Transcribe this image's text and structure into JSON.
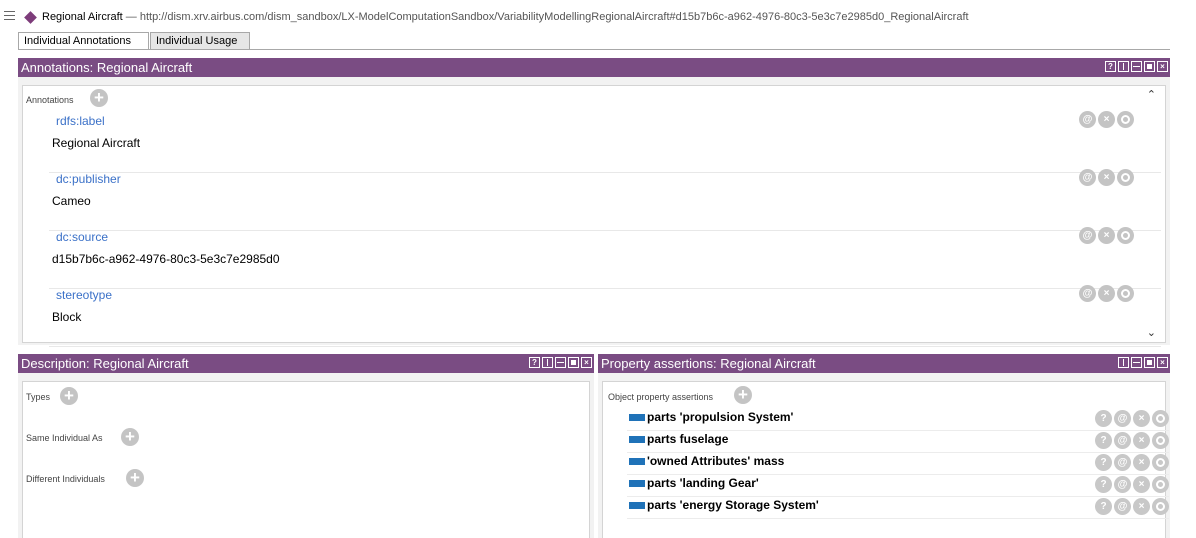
{
  "individual": {
    "name": "Regional Aircraft",
    "iri": "— http://dism.xrv.airbus.com/dism_sandbox/LX-ModelComputationSandbox/VariabilityModellingRegionalAircraft#d15b7b6c-a962-4976-80c3-5e3c7e2985d0_RegionalAircraft"
  },
  "tabs": [
    "Individual Annotations",
    "Individual Usage"
  ],
  "annotations_view": {
    "title": "Annotations: Regional Aircraft",
    "section_label": "Annotations",
    "items": [
      {
        "property": "rdfs:label",
        "value": "Regional Aircraft"
      },
      {
        "property": "dc:publisher",
        "value": "Cameo"
      },
      {
        "property": "dc:source",
        "value": "d15b7b6c-a962-4976-80c3-5e3c7e2985d0"
      },
      {
        "property": "stereotype",
        "value": "Block"
      }
    ]
  },
  "description_view": {
    "title": "Description: Regional Aircraft",
    "sections": [
      "Types",
      "Same Individual As",
      "Different Individuals"
    ]
  },
  "property_view": {
    "title": "Property assertions: Regional Aircraft",
    "section_label": "Object property assertions",
    "items": [
      "parts  'propulsion System'",
      "parts  fuselage",
      "'owned Attributes'  mass",
      "parts  'landing Gear'",
      "parts  'energy Storage System'"
    ]
  },
  "glyphs": {
    "plus": "+",
    "at": "@",
    "x": "×",
    "help": "?"
  },
  "colors": {
    "view_header": "#7a4c83",
    "individual_icon": "#7d3c7a",
    "annotation_property": "#3b71c8",
    "object_property": "#1f72b8"
  }
}
